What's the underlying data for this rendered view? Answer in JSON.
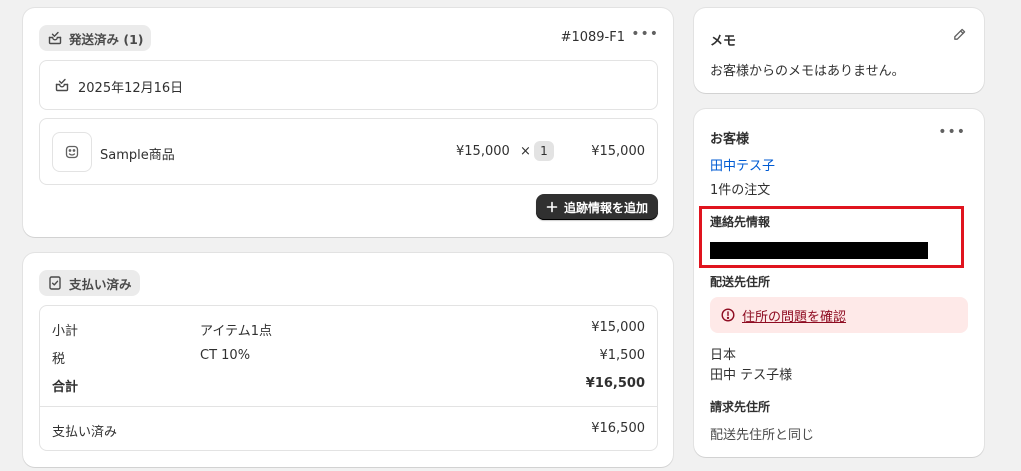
{
  "fulfillment": {
    "status_label": "発送済み (1)",
    "order_ref": "#1089-F1",
    "date": "2025年12月16日",
    "item": {
      "name": "Sample商品",
      "unit_price": "¥15,000",
      "times": "×",
      "quantity": "1",
      "total": "¥15,000"
    },
    "add_tracking_label": "追跡情報を追加"
  },
  "payment": {
    "status_label": "支払い済み",
    "rows": [
      {
        "label": "小計",
        "detail": "アイテム1点",
        "amount": "¥15,000"
      },
      {
        "label": "税",
        "detail": "CT 10%",
        "amount": "¥1,500"
      },
      {
        "label": "合計",
        "detail": "",
        "amount": "¥16,500"
      }
    ],
    "paid": {
      "label": "支払い済み",
      "amount": "¥16,500"
    }
  },
  "memo": {
    "title": "メモ",
    "body": "お客様からのメモはありません。"
  },
  "customer": {
    "title": "お客様",
    "name": "田中テス子",
    "orders": "1件の注文",
    "contact_title": "連絡先情報",
    "shipping_title": "配送先住所",
    "address_issue": "住所の問題を確認",
    "address_country": "日本",
    "address_name": "田中 テス子様",
    "billing_title": "請求先住所",
    "billing_body": "配送先住所と同じ"
  },
  "colors": {
    "highlight_border": "#e0141e",
    "link": "#005bd3",
    "critical_bg": "#fee9e8",
    "critical_text": "#8e0b21",
    "button_bg": "#303030"
  }
}
